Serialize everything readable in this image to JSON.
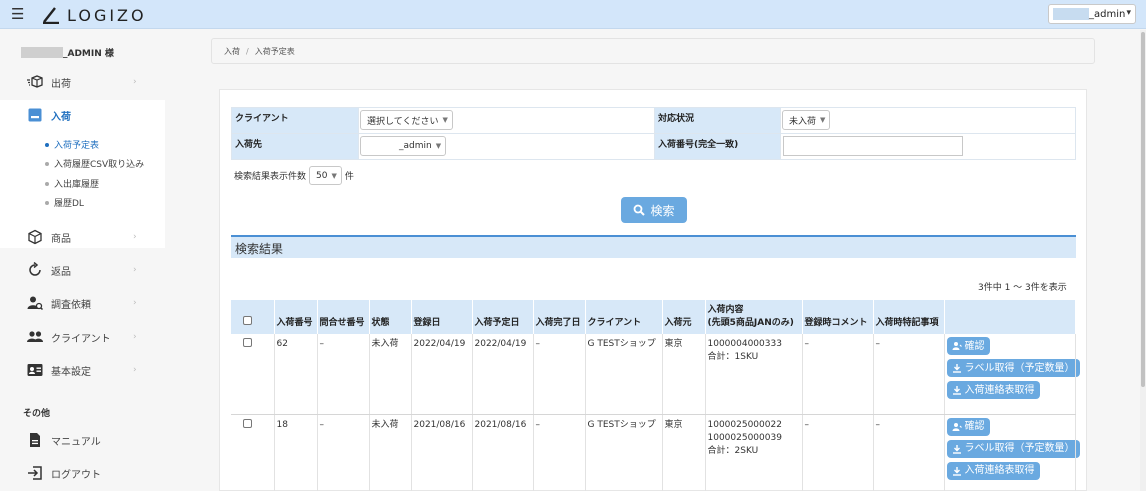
{
  "header": {
    "brand": "LOGIZO",
    "user_name": "_admin"
  },
  "sidebar": {
    "admin_suffix": "_ADMIN 様",
    "items": [
      {
        "label": "出荷",
        "icon": "shipping-box-icon"
      },
      {
        "label": "入荷",
        "icon": "inbox-icon"
      },
      {
        "label": "商品",
        "icon": "cube-icon"
      },
      {
        "label": "返品",
        "icon": "return-arrow-icon"
      },
      {
        "label": "調査依頼",
        "icon": "user-search-icon"
      },
      {
        "label": "クライアント",
        "icon": "users-icon"
      },
      {
        "label": "基本設定",
        "icon": "id-card-icon"
      }
    ],
    "sub_items": [
      "入荷予定表",
      "入荷履歴CSV取り込み",
      "入出庫履歴",
      "履歴DL"
    ],
    "section_other": "その他",
    "other_items": [
      {
        "label": "マニュアル",
        "icon": "document-icon"
      },
      {
        "label": "ログアウト",
        "icon": "logout-icon"
      }
    ]
  },
  "breadcrumb": {
    "parent": "入荷",
    "current": "入荷予定表"
  },
  "search_form": {
    "client_label": "クライアント",
    "client_value": "選択してください",
    "status_label": "対応状況",
    "status_value": "未入荷",
    "destination_label": "入荷先",
    "destination_value": "_admin",
    "arrival_no_label": "入荷番号(完全一致)",
    "arrival_no_value": "",
    "per_page_prefix": "検索結果表示件数",
    "per_page_value": "50",
    "per_page_suffix": "件",
    "search_button": "検索"
  },
  "results": {
    "title": "検索結果",
    "count_text": "3件中 1 ～ 3件を表示",
    "columns": [
      "入荷番号",
      "問合せ番号",
      "状態",
      "登録日",
      "入荷予定日",
      "入荷完了日",
      "クライアント",
      "入荷元",
      "入荷内容\n(先頭5商品JANのみ)",
      "登録時コメント",
      "入荷時特記事項"
    ],
    "rows": [
      {
        "arrival_no": "62",
        "inquiry_no": "–",
        "status": "未入荷",
        "registered": "2022/04/19",
        "scheduled": "2022/04/19",
        "completed": "–",
        "client": "G TESTショップ",
        "origin": "東京",
        "contents": [
          "1000004000333",
          "合計：1SKU"
        ],
        "comment": "–",
        "notes": "–"
      },
      {
        "arrival_no": "18",
        "inquiry_no": "–",
        "status": "未入荷",
        "registered": "2021/08/16",
        "scheduled": "2021/08/16",
        "completed": "–",
        "client": "G TESTショップ",
        "origin": "東京",
        "contents": [
          "1000025000022",
          "1000025000039",
          "合計：2SKU"
        ],
        "comment": "–",
        "notes": "–"
      }
    ],
    "actions": {
      "confirm": "確認",
      "label": "ラベル取得（予定数量）",
      "sheet": "入荷連絡表取得"
    }
  },
  "colors": {
    "header_bg": "#d3e6fa",
    "accent": "#6aa9e0",
    "active_text": "#1f6fbf",
    "label_bg": "#d7e8f8"
  }
}
